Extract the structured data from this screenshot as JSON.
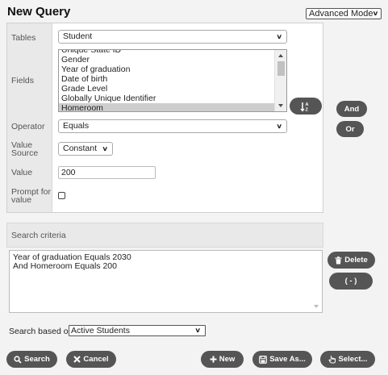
{
  "page": {
    "title": "New Query"
  },
  "mode_select": {
    "value": "Advanced Mode"
  },
  "form": {
    "tables": {
      "label": "Tables",
      "value": "Student"
    },
    "fields": {
      "label": "Fields",
      "items": [
        "Unique State ID",
        "Gender",
        "Year of graduation",
        "Date of birth",
        "Grade Level",
        "Globally Unique Identifier",
        "Homeroom"
      ],
      "selected": "Homeroom"
    },
    "operator": {
      "label": "Operator",
      "value": "Equals"
    },
    "value_source": {
      "label_line1": "Value",
      "label_line2": "Source",
      "value": "Constant"
    },
    "value": {
      "label": "Value",
      "value": "200"
    },
    "prompt": {
      "label_line1": "Prompt for",
      "label_line2": "value",
      "checked": false
    }
  },
  "side_buttons": {
    "and": "And",
    "or": "Or",
    "delete": "Delete",
    "group": "( - )"
  },
  "criteria": {
    "header": "Search criteria",
    "lines": [
      "Year of graduation Equals 2030",
      "And Homeroom Equals 200"
    ]
  },
  "search_based": {
    "label": "Search based on",
    "value": "Active Students"
  },
  "footer": {
    "search": "Search",
    "cancel": "Cancel",
    "new": "New",
    "save_as": "Save As...",
    "select": "Select..."
  },
  "colors": {
    "button_bg": "#555555",
    "page_bg": "#f3f3f3",
    "label_bg": "#e9e9e9"
  }
}
